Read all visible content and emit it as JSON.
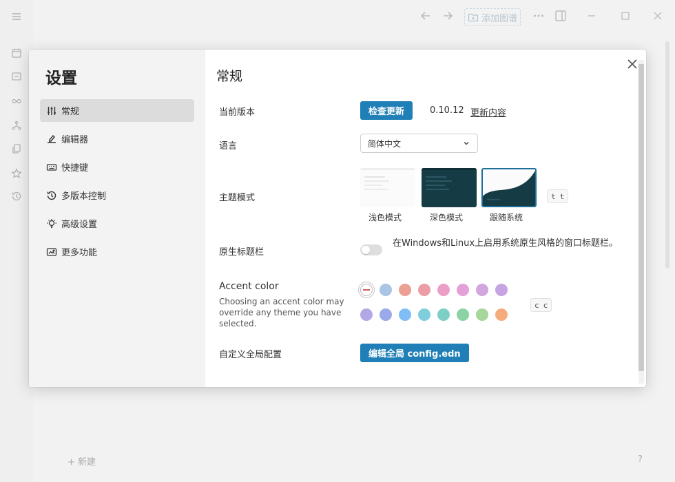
{
  "app": {
    "titlebar": {
      "add_graph_label": "添加图谱"
    },
    "left_rail_icons": [
      "menu-icon",
      "calendar-icon",
      "whiteboard-icon",
      "infinity-icon",
      "graph-icon",
      "pages-icon",
      "star-icon",
      "history-icon"
    ],
    "new_page_label": "+ 新建",
    "help_label": "?"
  },
  "settings": {
    "title": "设置",
    "nav": [
      {
        "label": "常规",
        "icon": "sliders-icon",
        "active": true
      },
      {
        "label": "编辑器",
        "icon": "editor-icon",
        "active": false
      },
      {
        "label": "快捷键",
        "icon": "keyboard-icon",
        "active": false
      },
      {
        "label": "多版本控制",
        "icon": "version-history-icon",
        "active": false
      },
      {
        "label": "高级设置",
        "icon": "bulb-icon",
        "active": false
      },
      {
        "label": "更多功能",
        "icon": "features-icon",
        "active": false
      }
    ],
    "section_title": "常规",
    "current_version": {
      "label": "当前版本",
      "check_button": "检查更新",
      "version": "0.10.12",
      "changelog_link": "更新内容"
    },
    "language": {
      "label": "语言",
      "selected": "简体中文"
    },
    "theme_mode": {
      "label": "主题模式",
      "options": [
        {
          "label": "浅色模式",
          "selected": false
        },
        {
          "label": "深色模式",
          "selected": false
        },
        {
          "label": "跟随系统",
          "selected": true
        }
      ],
      "shortcut": [
        "t",
        "t"
      ]
    },
    "native_titlebar": {
      "label": "原生标题栏",
      "enabled": false,
      "description": "在Windows和Linux上启用系统原生风格的窗口标题栏。"
    },
    "accent_color": {
      "label": "Accent color",
      "description": "Choosing an accent color may override any theme you have selected.",
      "colors": [
        "none",
        "#a9c4e4",
        "#ec9f93",
        "#ec9da6",
        "#ec9ec6",
        "#e3a1d8",
        "#d3a6e0",
        "#c6a3e2",
        "#b3a7e6",
        "#99a9ea",
        "#80bdf5",
        "#7ecfdb",
        "#7dcfc5",
        "#8bd2a5",
        "#a6d69a",
        "#f6ad7b"
      ],
      "shortcut": [
        "c",
        "c"
      ]
    },
    "custom_config": {
      "label": "自定义全局配置",
      "button": "编辑全局 config.edn"
    }
  }
}
